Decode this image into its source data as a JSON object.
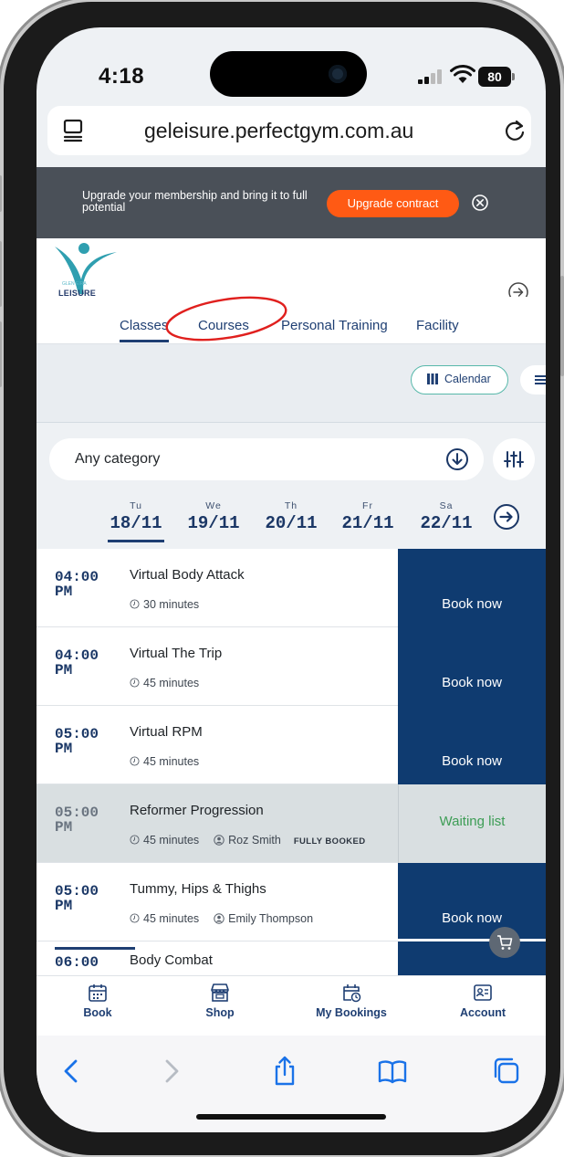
{
  "status": {
    "time": "4:18",
    "battery": "80"
  },
  "browser": {
    "url": "geleisure.perfectgym.com.au"
  },
  "banner": {
    "message": "Upgrade your membership and bring it to full potential",
    "button_label": "Upgrade contract"
  },
  "logo": {
    "small_text": "GLEN EIRA",
    "main_text": "LEISURE"
  },
  "tabs": [
    {
      "label": "Classes",
      "active": true
    },
    {
      "label": "Courses",
      "active": false
    },
    {
      "label": "Personal Training",
      "active": false
    },
    {
      "label": "Facility",
      "active": false
    }
  ],
  "view_toggle": {
    "calendar_label": "Calendar"
  },
  "filter": {
    "category_value": "Any category"
  },
  "days": [
    {
      "name": "Tu",
      "date": "18/11",
      "active": true
    },
    {
      "name": "We",
      "date": "19/11",
      "active": false
    },
    {
      "name": "Th",
      "date": "20/11",
      "active": false
    },
    {
      "name": "Fr",
      "date": "21/11",
      "active": false
    },
    {
      "name": "Sa",
      "date": "22/11",
      "active": false
    }
  ],
  "classes": [
    {
      "time": "04:00",
      "ampm": "PM",
      "title": "Virtual Body Attack",
      "duration": "30 minutes",
      "instructor": "",
      "status": "",
      "action": "Book now"
    },
    {
      "time": "04:00",
      "ampm": "PM",
      "title": "Virtual The Trip",
      "duration": "45 minutes",
      "instructor": "",
      "status": "",
      "action": "Book now"
    },
    {
      "time": "05:00",
      "ampm": "PM",
      "title": "Virtual RPM",
      "duration": "45 minutes",
      "instructor": "",
      "status": "",
      "action": "Book now"
    },
    {
      "time": "05:00",
      "ampm": "PM",
      "title": "Reformer Progression",
      "duration": "45 minutes",
      "instructor": "Roz Smith",
      "status": "FULLY BOOKED",
      "action": "Waiting list"
    },
    {
      "time": "05:00",
      "ampm": "PM",
      "title": "Tummy, Hips & Thighs",
      "duration": "45 minutes",
      "instructor": "Emily Thompson",
      "status": "",
      "action": "Book now"
    },
    {
      "time": "06:00",
      "ampm": "",
      "title": "Body Combat",
      "duration": "",
      "instructor": "",
      "status": "",
      "action": ""
    }
  ],
  "app_nav": [
    {
      "label": "Book",
      "icon": "calendar-grid-icon"
    },
    {
      "label": "Shop",
      "icon": "shop-icon"
    },
    {
      "label": "My Bookings",
      "icon": "calendar-clock-icon"
    },
    {
      "label": "Account",
      "icon": "account-card-icon"
    }
  ],
  "colors": {
    "brand_navy": "#0f3b70",
    "accent_orange": "#ff5a14",
    "waiting_green": "#3d9d55",
    "calendar_outline": "#57b8aa",
    "annotation_red": "#e0201e"
  }
}
